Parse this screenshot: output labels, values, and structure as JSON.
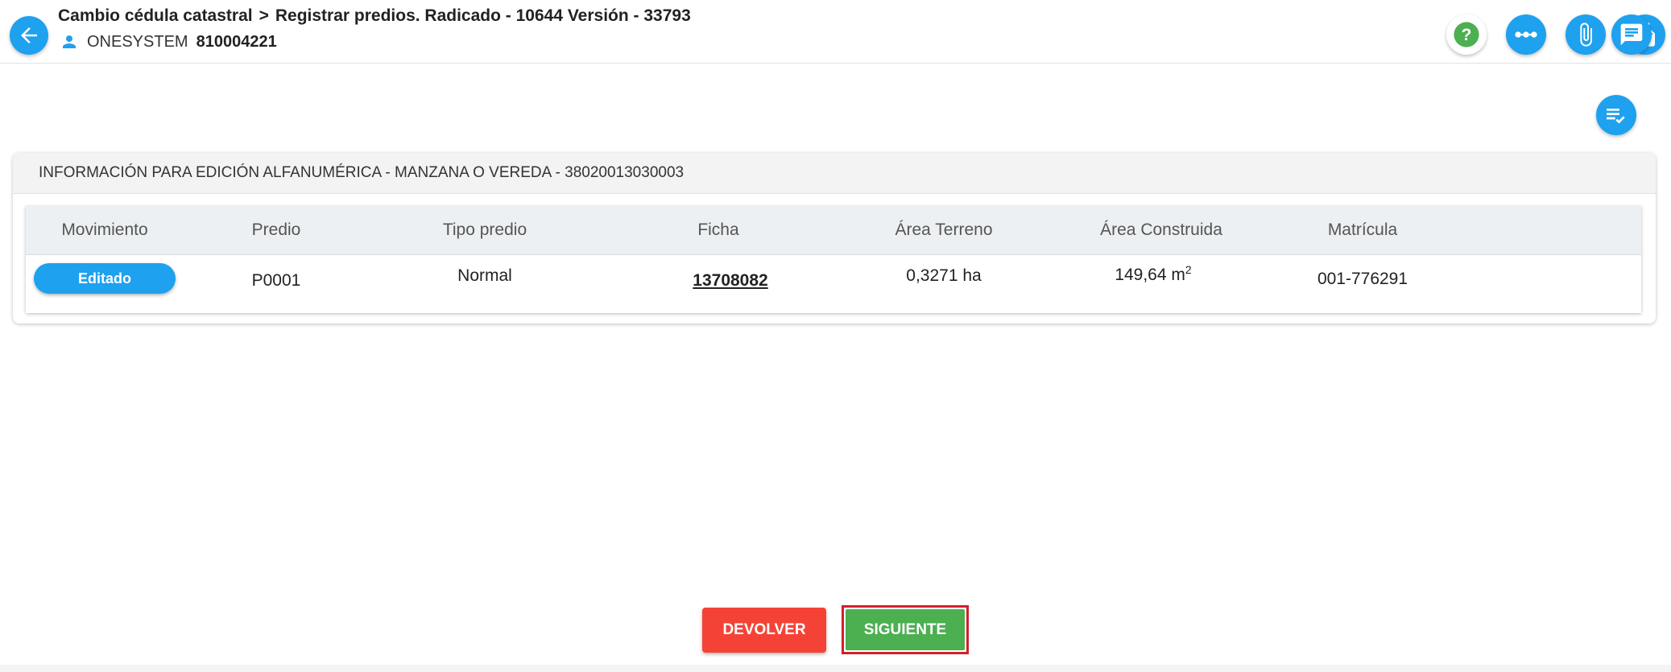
{
  "header": {
    "breadcrumb_root": "Cambio cédula catastral",
    "breadcrumb_current": "Registrar predios. Radicado - 10644 Versión - 33793",
    "user_name": "ONESYSTEM",
    "user_id": "810004221",
    "icons": [
      "help-icon",
      "more-icon",
      "attachment-icon",
      "documents-icon",
      "comments-icon"
    ]
  },
  "card": {
    "title": "INFORMACIÓN PARA EDICIÓN ALFANUMÉRICA - MANZANA O VEREDA - 38020013030003"
  },
  "table": {
    "columns": [
      "Movimiento",
      "Predio",
      "Tipo predio",
      "Ficha",
      "Área Terreno",
      "Área Construida",
      "Matrícula"
    ],
    "rows": [
      {
        "movimiento": "Editado",
        "predio": "P0001",
        "tipo_predio": "Normal",
        "ficha": "13708082",
        "area_terreno": "0,3271 ha",
        "area_construida": "149,64 m",
        "area_construida_sup": "2",
        "matricula": "001-776291"
      }
    ]
  },
  "actions": {
    "devolver": "DEVOLVER",
    "siguiente": "SIGUIENTE"
  },
  "colors": {
    "primary": "#1ea1ee",
    "danger": "#f44336",
    "success": "#4caf50",
    "highlight": "#d11f2d"
  }
}
